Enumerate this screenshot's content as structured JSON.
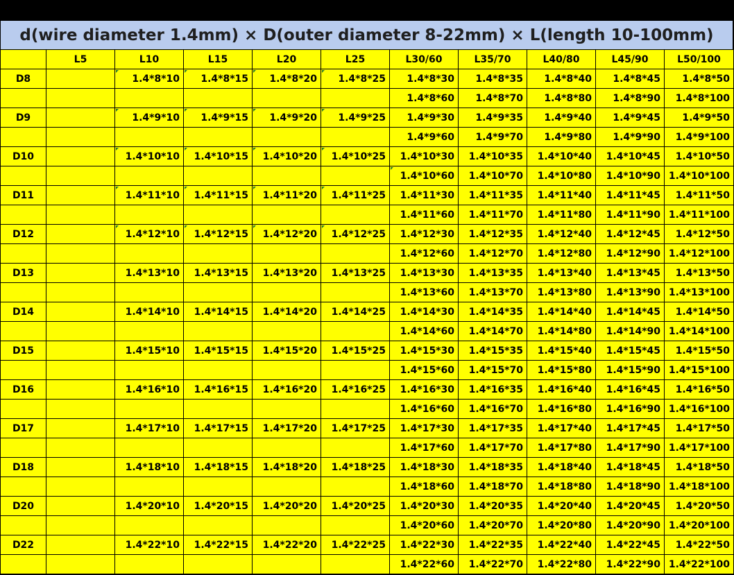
{
  "title": "d(wire diameter 1.4mm) × D(outer diameter 8-22mm) × L(length 10-100mm)",
  "headers": [
    "",
    "L5",
    "L10",
    "L15",
    "L20",
    "L25",
    "L30/60",
    "L35/70",
    "L40/80",
    "L45/90",
    "L50/100"
  ],
  "rows": [
    {
      "label": "D8",
      "first": [
        "1.4*8*10",
        "1.4*8*15",
        "1.4*8*20",
        "1.4*8*25",
        "1.4*8*30",
        "1.4*8*35",
        "1.4*8*40",
        "1.4*8*45",
        "1.4*8*50"
      ],
      "second": [
        "1.4*8*60",
        "1.4*8*70",
        "1.4*8*80",
        "1.4*8*90",
        "1.4*8*100"
      ]
    },
    {
      "label": "D9",
      "first": [
        "1.4*9*10",
        "1.4*9*15",
        "1.4*9*20",
        "1.4*9*25",
        "1.4*9*30",
        "1.4*9*35",
        "1.4*9*40",
        "1.4*9*45",
        "1.4*9*50"
      ],
      "second": [
        "1.4*9*60",
        "1.4*9*70",
        "1.4*9*80",
        "1.4*9*90",
        "1.4*9*100"
      ]
    },
    {
      "label": "D10",
      "first": [
        "1.4*10*10",
        "1.4*10*15",
        "1.4*10*20",
        "1.4*10*25",
        "1.4*10*30",
        "1.4*10*35",
        "1.4*10*40",
        "1.4*10*45",
        "1.4*10*50"
      ],
      "second": [
        "1.4*10*60",
        "1.4*10*70",
        "1.4*10*80",
        "1.4*10*90",
        "1.4*10*100"
      ]
    },
    {
      "label": "D11",
      "first": [
        "1.4*11*10",
        "1.4*11*15",
        "1.4*11*20",
        "1.4*11*25",
        "1.4*11*30",
        "1.4*11*35",
        "1.4*11*40",
        "1.4*11*45",
        "1.4*11*50"
      ],
      "second": [
        "1.4*11*60",
        "1.4*11*70",
        "1.4*11*80",
        "1.4*11*90",
        "1.4*11*100"
      ]
    },
    {
      "label": "D12",
      "first": [
        "1.4*12*10",
        "1.4*12*15",
        "1.4*12*20",
        "1.4*12*25",
        "1.4*12*30",
        "1.4*12*35",
        "1.4*12*40",
        "1.4*12*45",
        "1.4*12*50"
      ],
      "second": [
        "1.4*12*60",
        "1.4*12*70",
        "1.4*12*80",
        "1.4*12*90",
        "1.4*12*100"
      ]
    },
    {
      "label": "D13",
      "first": [
        "1.4*13*10",
        "1.4*13*15",
        "1.4*13*20",
        "1.4*13*25",
        "1.4*13*30",
        "1.4*13*35",
        "1.4*13*40",
        "1.4*13*45",
        "1.4*13*50"
      ],
      "second": [
        "1.4*13*60",
        "1.4*13*70",
        "1.4*13*80",
        "1.4*13*90",
        "1.4*13*100"
      ]
    },
    {
      "label": "D14",
      "first": [
        "1.4*14*10",
        "1.4*14*15",
        "1.4*14*20",
        "1.4*14*25",
        "1.4*14*30",
        "1.4*14*35",
        "1.4*14*40",
        "1.4*14*45",
        "1.4*14*50"
      ],
      "second": [
        "1.4*14*60",
        "1.4*14*70",
        "1.4*14*80",
        "1.4*14*90",
        "1.4*14*100"
      ]
    },
    {
      "label": "D15",
      "first": [
        "1.4*15*10",
        "1.4*15*15",
        "1.4*15*20",
        "1.4*15*25",
        "1.4*15*30",
        "1.4*15*35",
        "1.4*15*40",
        "1.4*15*45",
        "1.4*15*50"
      ],
      "second": [
        "1.4*15*60",
        "1.4*15*70",
        "1.4*15*80",
        "1.4*15*90",
        "1.4*15*100"
      ]
    },
    {
      "label": "D16",
      "first": [
        "1.4*16*10",
        "1.4*16*15",
        "1.4*16*20",
        "1.4*16*25",
        "1.4*16*30",
        "1.4*16*35",
        "1.4*16*40",
        "1.4*16*45",
        "1.4*16*50"
      ],
      "second": [
        "1.4*16*60",
        "1.4*16*70",
        "1.4*16*80",
        "1.4*16*90",
        "1.4*16*100"
      ]
    },
    {
      "label": "D17",
      "first": [
        "1.4*17*10",
        "1.4*17*15",
        "1.4*17*20",
        "1.4*17*25",
        "1.4*17*30",
        "1.4*17*35",
        "1.4*17*40",
        "1.4*17*45",
        "1.4*17*50"
      ],
      "second": [
        "1.4*17*60",
        "1.4*17*70",
        "1.4*17*80",
        "1.4*17*90",
        "1.4*17*100"
      ]
    },
    {
      "label": "D18",
      "first": [
        "1.4*18*10",
        "1.4*18*15",
        "1.4*18*20",
        "1.4*18*25",
        "1.4*18*30",
        "1.4*18*35",
        "1.4*18*40",
        "1.4*18*45",
        "1.4*18*50"
      ],
      "second": [
        "1.4*18*60",
        "1.4*18*70",
        "1.4*18*80",
        "1.4*18*90",
        "1.4*18*100"
      ]
    },
    {
      "label": "D20",
      "first": [
        "1.4*20*10",
        "1.4*20*15",
        "1.4*20*20",
        "1.4*20*25",
        "1.4*20*30",
        "1.4*20*35",
        "1.4*20*40",
        "1.4*20*45",
        "1.4*20*50"
      ],
      "second": [
        "1.4*20*60",
        "1.4*20*70",
        "1.4*20*80",
        "1.4*20*90",
        "1.4*20*100"
      ]
    },
    {
      "label": "D22",
      "first": [
        "1.4*22*10",
        "1.4*22*15",
        "1.4*22*20",
        "1.4*22*25",
        "1.4*22*30",
        "1.4*22*35",
        "1.4*22*40",
        "1.4*22*45",
        "1.4*22*50"
      ],
      "second": [
        "1.4*22*60",
        "1.4*22*70",
        "1.4*22*80",
        "1.4*22*90",
        "1.4*22*100"
      ]
    }
  ],
  "colors": {
    "cell": "#ffff00",
    "title_bg": "#b9ccee",
    "grid_line": "#000000",
    "corner_mark": "#2a7d2a"
  }
}
